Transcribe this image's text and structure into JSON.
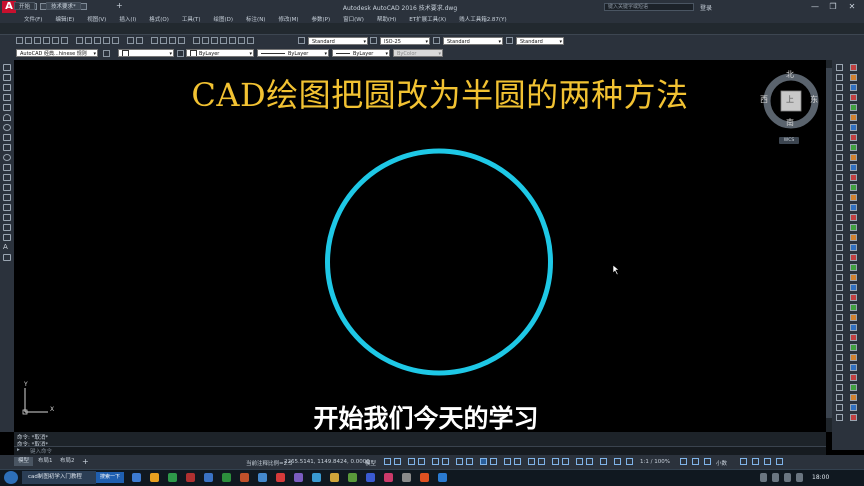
{
  "app": {
    "title": "Autodesk AutoCAD 2016    技术要求.dwg",
    "search_placeholder": "键入关键字或短语",
    "user": "登录",
    "window_controls": [
      "—",
      "❐",
      "✕"
    ]
  },
  "menu": [
    "文件(F)",
    "编辑(E)",
    "视图(V)",
    "插入(I)",
    "格式(O)",
    "工具(T)",
    "绘图(D)",
    "标注(N)",
    "修改(M)",
    "参数(P)",
    "窗口(W)",
    "帮助(H)",
    "ET扩展工具(X)",
    "贱人工具箱2.87(Y)"
  ],
  "tabs": [
    {
      "label": "开始"
    },
    {
      "label": "技术要求*"
    }
  ],
  "toolbar": {
    "workspace": "AutoCAD 经典...hinese 规则",
    "layer": "ByLayer",
    "linetype": "ByLayer",
    "lineweight": "ByLayer",
    "plotstyle": "ByColor",
    "text_style": "Standard",
    "dim_style": "ISO-25",
    "table_style": "Standard",
    "mleader_style": "Standard"
  },
  "canvas": {
    "title": "CAD绘图把圆改为半圆的两种方法",
    "subtitle": "开始我们今天的学习",
    "circle_color": "#1ec8e6",
    "title_color": "#f2c232"
  },
  "viewcube": {
    "north": "北",
    "south": "南",
    "east": "东",
    "west": "西",
    "top": "上",
    "wcs": "WCS"
  },
  "ucs": {
    "x": "X",
    "y": "Y"
  },
  "command": {
    "history": [
      "命令: *取消*",
      "命令: *取消*"
    ],
    "placeholder": "键入命令"
  },
  "layout_tabs": [
    "模型",
    "布局1",
    "布局2"
  ],
  "status": {
    "scale": "当前注释比例=2.5",
    "coords": "2265.5141, 1149.8424, 0.0000",
    "mode": "模型",
    "zoom": "1:1 / 100%",
    "units": "小数"
  },
  "taskbar": {
    "app": "cad制图初学入门教程",
    "search": "搜索一下",
    "clock": "18:00"
  }
}
